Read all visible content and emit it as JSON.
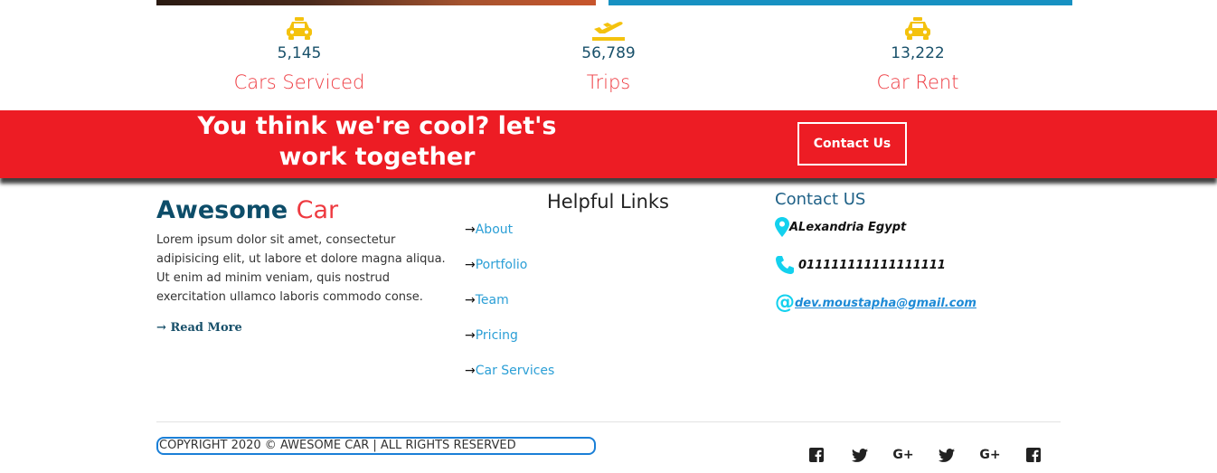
{
  "stats": [
    {
      "icon": "taxi-icon",
      "value": "5,145",
      "label": "Cars Serviced"
    },
    {
      "icon": "plane-departure-icon",
      "value": "56,789",
      "label": "Trips"
    },
    {
      "icon": "taxi-icon",
      "value": "13,222",
      "label": "Car Rent"
    }
  ],
  "banner": {
    "headline": "You think we're cool? let's work together",
    "cta_label": "Contact Us",
    "color": "#ed1c24"
  },
  "about": {
    "brand_main": "Awesome",
    "brand_accent": "Car",
    "text": "Lorem ipsum dolor sit amet, consectetur adipisicing elit, ut labore et dolore magna aliqua. Ut enim ad minim veniam, quis nostrud exercitation ullamco laboris commodo conse.",
    "read_more": "Read More"
  },
  "helpful_links": {
    "title": "Helpful Links",
    "items": [
      "About",
      "Portfolio",
      "Team",
      "Pricing",
      "Car Services"
    ]
  },
  "contact": {
    "title": "Contact US",
    "address": "ALexandria Egypt",
    "phone": "011111111111111111",
    "email": "dev.moustapha@gmail.com"
  },
  "footer": {
    "copyright": "COPYRIGHT 2020 © AWESOME CAR | ALL RIGHTS RESERVED",
    "social": [
      {
        "icon": "facebook-icon"
      },
      {
        "icon": "twitter-icon"
      },
      {
        "icon": "google-plus-icon",
        "text": "G+"
      },
      {
        "icon": "twitter-icon"
      },
      {
        "icon": "google-plus-icon",
        "text": "G+"
      },
      {
        "icon": "facebook-icon"
      }
    ]
  },
  "colors": {
    "accent_red": "#ee3a40",
    "brand_navy": "#0d4d69",
    "link_blue": "#2b9fd6",
    "stat_icon_gold": "#f4c20d",
    "contact_icon_cyan": "#13d1ee"
  }
}
